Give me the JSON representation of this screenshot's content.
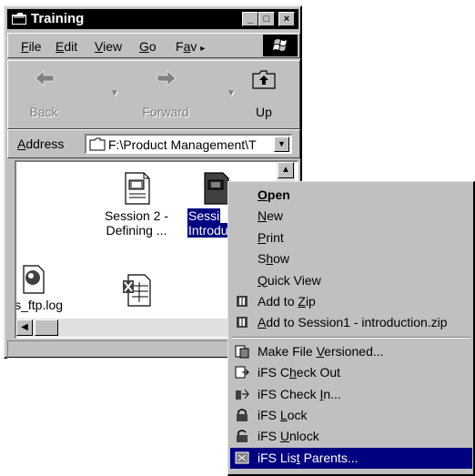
{
  "window": {
    "title": "Training",
    "controls": {
      "minimize": "_",
      "maximize": "□",
      "close": "×"
    }
  },
  "menubar": {
    "items": [
      {
        "label": "File",
        "key": "F",
        "rest": "ile"
      },
      {
        "label": "Edit",
        "key": "E",
        "rest": "dit"
      },
      {
        "label": "View",
        "key": "V",
        "rest": "iew"
      },
      {
        "label": "Go",
        "key": "G",
        "rest": "o"
      },
      {
        "label": "Fav",
        "key": "a",
        "pre": "F",
        "rest": "v"
      }
    ],
    "overflow": "▸"
  },
  "toolbar": {
    "back": "Back",
    "forward": "Forward",
    "up": "Up"
  },
  "address": {
    "label": "Address",
    "value": "F:\\Product Management\\T"
  },
  "files": [
    {
      "line1": "Session 2 -",
      "line2": "Defining ..."
    },
    {
      "line1": "Sessi",
      "line2": "Introdu",
      "selected": true
    },
    {
      "line1": "ws_ftp.log",
      "line2": ""
    },
    {
      "line1": "",
      "line2": ""
    }
  ],
  "context_menu": {
    "items": [
      {
        "id": "open",
        "pre": "",
        "key": "O",
        "post": "pen",
        "bold": true,
        "icon": ""
      },
      {
        "id": "new",
        "pre": "",
        "key": "N",
        "post": "ew",
        "icon": ""
      },
      {
        "id": "print",
        "pre": "",
        "key": "P",
        "post": "rint",
        "icon": ""
      },
      {
        "id": "show",
        "pre": "S",
        "key": "h",
        "post": "ow",
        "icon": ""
      },
      {
        "id": "quick-view",
        "pre": "",
        "key": "Q",
        "post": "uick View",
        "icon": ""
      },
      {
        "id": "add-to-zip",
        "pre": "Add to ",
        "key": "Z",
        "post": "ip",
        "icon": "winzip-icon"
      },
      {
        "id": "add-to-session-zip",
        "pre": "",
        "key": "A",
        "post": "dd to Session1 - introduction.zip",
        "icon": "winzip-icon"
      },
      {
        "sep": true
      },
      {
        "id": "make-versioned",
        "pre": "Make File ",
        "key": "V",
        "post": "ersioned...",
        "icon": "ifs-version-icon"
      },
      {
        "id": "check-out",
        "pre": "iFS C",
        "key": "h",
        "post": "eck Out",
        "icon": "ifs-checkout-icon"
      },
      {
        "id": "check-in",
        "pre": "iFS Check ",
        "key": "I",
        "post": "n...",
        "icon": "ifs-checkin-icon"
      },
      {
        "id": "lock",
        "pre": "iFS ",
        "key": "L",
        "post": "ock",
        "icon": "lock-icon"
      },
      {
        "id": "unlock",
        "pre": "iFS ",
        "key": "U",
        "post": "nlock",
        "icon": "unlock-icon"
      },
      {
        "id": "list-parents",
        "pre": "iFS Lis",
        "key": "t",
        "post": " Parents...",
        "icon": "ifs-parents-icon",
        "highlight": true
      }
    ]
  }
}
